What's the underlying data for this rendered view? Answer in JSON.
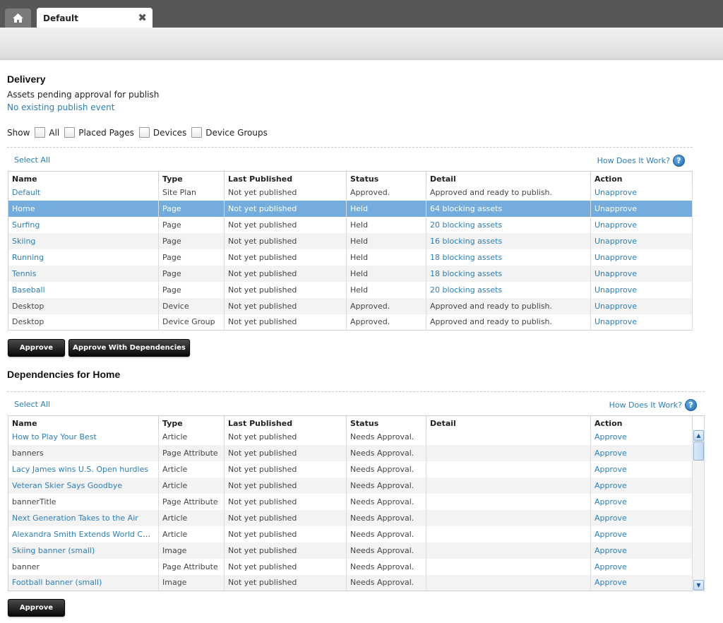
{
  "tabs": {
    "home_icon": "home-icon",
    "active_tab": "Default",
    "close_glyph": "✖"
  },
  "delivery": {
    "title": "Delivery",
    "subtitle": "Assets pending approval for publish",
    "publish_event": "No existing publish event",
    "show": {
      "label": "Show",
      "options": [
        "All",
        "Placed Pages",
        "Devices",
        "Device Groups"
      ]
    },
    "select_all": "Select All",
    "how_link": "How Does It Work?",
    "columns": [
      "Name",
      "Type",
      "Last Published",
      "Status",
      "Detail",
      "Action"
    ],
    "rows": [
      {
        "name": "Default",
        "type": "Site Plan",
        "last": "Not yet published",
        "status": "Approved.",
        "detail": "Approved and ready to publish.",
        "action": "Unapprove"
      },
      {
        "name": "Home",
        "type": "Page",
        "last": "Not yet published",
        "status": "Held",
        "detail": "64 blocking assets",
        "action": "Unapprove"
      },
      {
        "name": "Surfing",
        "type": "Page",
        "last": "Not yet published",
        "status": "Held",
        "detail": "20 blocking assets",
        "action": "Unapprove"
      },
      {
        "name": "Skiing",
        "type": "Page",
        "last": "Not yet published",
        "status": "Held",
        "detail": "16 blocking assets",
        "action": "Unapprove"
      },
      {
        "name": "Running",
        "type": "Page",
        "last": "Not yet published",
        "status": "Held",
        "detail": "18 blocking assets",
        "action": "Unapprove"
      },
      {
        "name": "Tennis",
        "type": "Page",
        "last": "Not yet published",
        "status": "Held",
        "detail": "18 blocking assets",
        "action": "Unapprove"
      },
      {
        "name": "Baseball",
        "type": "Page",
        "last": "Not yet published",
        "status": "Held",
        "detail": "20 blocking assets",
        "action": "Unapprove"
      },
      {
        "name": "Desktop",
        "type": "Device",
        "last": "Not yet published",
        "status": "Approved.",
        "detail": "Approved and ready to publish.",
        "action": "Unapprove"
      },
      {
        "name": "Desktop",
        "type": "Device Group",
        "last": "Not yet published",
        "status": "Approved.",
        "detail": "Approved and ready to publish.",
        "action": "Unapprove"
      }
    ],
    "buttons": {
      "approve": "Approve",
      "approve_deps": "Approve With Dependencies"
    }
  },
  "dependencies": {
    "title": "Dependencies for Home",
    "select_all": "Select All",
    "how_link": "How Does It Work?",
    "columns": [
      "Name",
      "Type",
      "Last Published",
      "Status",
      "Detail",
      "Action"
    ],
    "rows": [
      {
        "name": "How to Play Your Best",
        "type": "Article",
        "last": "Not yet published",
        "status": "Needs Approval.",
        "detail": "",
        "action": "Approve"
      },
      {
        "name": "banners",
        "type": "Page Attribute",
        "last": "Not yet published",
        "status": "Needs Approval.",
        "detail": "",
        "action": "Approve"
      },
      {
        "name": "Lacy James wins U.S. Open hurdles",
        "type": "Article",
        "last": "Not yet published",
        "status": "Needs Approval.",
        "detail": "",
        "action": "Approve"
      },
      {
        "name": "Veteran Skier Says Goodbye",
        "type": "Article",
        "last": "Not yet published",
        "status": "Needs Approval.",
        "detail": "",
        "action": "Approve"
      },
      {
        "name": "bannerTitle",
        "type": "Page Attribute",
        "last": "Not yet published",
        "status": "Needs Approval.",
        "detail": "",
        "action": "Approve"
      },
      {
        "name": "Next Generation Takes to the Air",
        "type": "Article",
        "last": "Not yet published",
        "status": "Needs Approval.",
        "detail": "",
        "action": "Approve"
      },
      {
        "name": "Alexandra Smith Extends World Cup Le...",
        "type": "Article",
        "last": "Not yet published",
        "status": "Needs Approval.",
        "detail": "",
        "action": "Approve"
      },
      {
        "name": "Skiing banner (small)",
        "type": "Image",
        "last": "Not yet published",
        "status": "Needs Approval.",
        "detail": "",
        "action": "Approve"
      },
      {
        "name": "banner",
        "type": "Page Attribute",
        "last": "Not yet published",
        "status": "Needs Approval.",
        "detail": "",
        "action": "Approve"
      },
      {
        "name": "Football banner (small)",
        "type": "Image",
        "last": "Not yet published",
        "status": "Needs Approval.",
        "detail": "",
        "action": "Approve"
      }
    ],
    "buttons": {
      "approve": "Approve"
    }
  },
  "colors": {
    "link": "#2a7fb8",
    "selected_row": "#74addd",
    "tabbar": "#575757"
  }
}
